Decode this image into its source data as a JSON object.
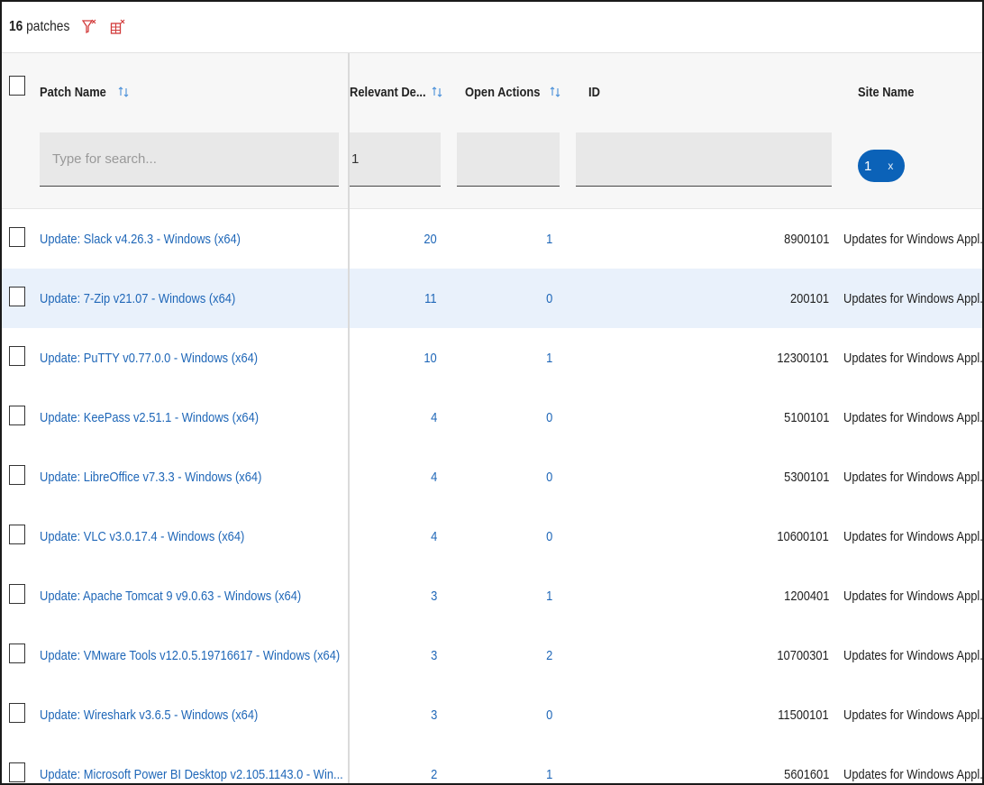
{
  "toolbar": {
    "count_number": "16",
    "count_label": "patches",
    "icons": [
      "clear-filters-icon",
      "clear-table-filters-icon"
    ]
  },
  "colors": {
    "link": "#1f67b8",
    "pill": "#0b62b8",
    "selected_row": "#e9f1fb",
    "icon_red": "#d23b3b"
  },
  "columns": {
    "patch_name": "Patch Name",
    "relevant_devices": "Relevant De...",
    "open_actions": "Open Actions",
    "id": "ID",
    "site_name": "Site Name"
  },
  "filters": {
    "patch_name_placeholder": "Type for search...",
    "relevant_devices_value": "1",
    "open_actions_value": "",
    "id_value": "",
    "site_name_chip": "1",
    "site_name_chip_remove": "x"
  },
  "rows": [
    {
      "name": "Update: Slack v4.26.3 - Windows (x64)",
      "relevant": "20",
      "open": "1",
      "id": "8900101",
      "site": "Updates for Windows Appl..",
      "selected": false
    },
    {
      "name": "Update: 7-Zip v21.07 - Windows (x64)",
      "relevant": "11",
      "open": "0",
      "id": "200101",
      "site": "Updates for Windows Appl..",
      "selected": true
    },
    {
      "name": "Update: PuTTY v0.77.0.0 - Windows (x64)",
      "relevant": "10",
      "open": "1",
      "id": "12300101",
      "site": "Updates for Windows Appl..",
      "selected": false
    },
    {
      "name": "Update: KeePass v2.51.1 - Windows (x64)",
      "relevant": "4",
      "open": "0",
      "id": "5100101",
      "site": "Updates for Windows Appl..",
      "selected": false
    },
    {
      "name": "Update: LibreOffice v7.3.3 - Windows (x64)",
      "relevant": "4",
      "open": "0",
      "id": "5300101",
      "site": "Updates for Windows Appl..",
      "selected": false
    },
    {
      "name": "Update: VLC v3.0.17.4 - Windows (x64)",
      "relevant": "4",
      "open": "0",
      "id": "10600101",
      "site": "Updates for Windows Appl..",
      "selected": false
    },
    {
      "name": "Update: Apache Tomcat 9 v9.0.63 - Windows (x64)",
      "relevant": "3",
      "open": "1",
      "id": "1200401",
      "site": "Updates for Windows Appl..",
      "selected": false
    },
    {
      "name": "Update: VMware Tools v12.0.5.19716617 - Windows (x64)",
      "relevant": "3",
      "open": "2",
      "id": "10700301",
      "site": "Updates for Windows Appl..",
      "selected": false
    },
    {
      "name": "Update: Wireshark v3.6.5 - Windows (x64)",
      "relevant": "3",
      "open": "0",
      "id": "11500101",
      "site": "Updates for Windows Appl..",
      "selected": false
    },
    {
      "name": "Update: Microsoft Power BI Desktop v2.105.1143.0 - Win...",
      "relevant": "2",
      "open": "1",
      "id": "5601601",
      "site": "Updates for Windows Appl..",
      "selected": false
    }
  ]
}
